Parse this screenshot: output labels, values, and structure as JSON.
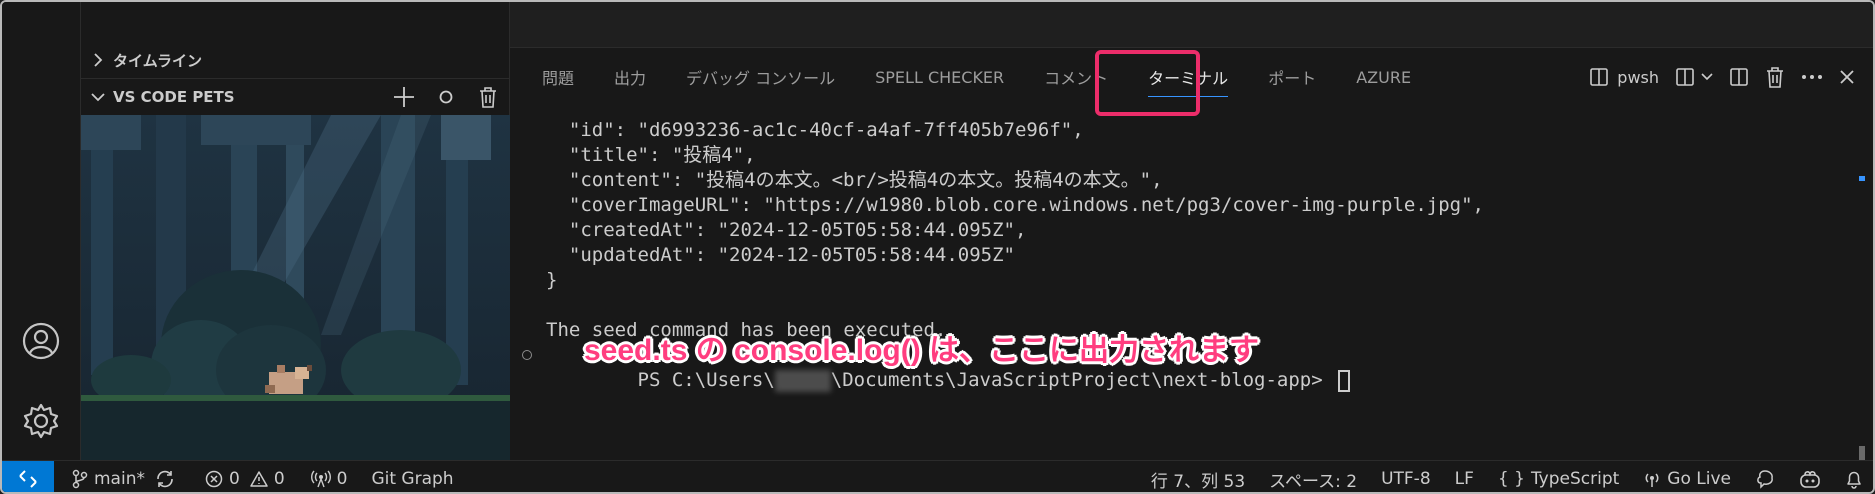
{
  "sidebar": {
    "timeline_label": "タイムライン",
    "pets_label": "VS CODE PETS"
  },
  "panel": {
    "tabs": [
      {
        "label": "問題"
      },
      {
        "label": "出力"
      },
      {
        "label": "デバッグ コンソール"
      },
      {
        "label": "SPELL CHECKER"
      },
      {
        "label": "コメント"
      },
      {
        "label": "ターミナル"
      },
      {
        "label": "ポート"
      },
      {
        "label": "AZURE"
      }
    ],
    "active_tab": "ターミナル",
    "shell_name": "pwsh"
  },
  "terminal": {
    "lines": [
      "  \"id\": \"d6993236-ac1c-40cf-a4af-7ff405b7e96f\",",
      "  \"title\": \"投稿4\",",
      "  \"content\": \"投稿4の本文。<br/>投稿4の本文。投稿4の本文。\",",
      "  \"coverImageURL\": \"https://w1980.blob.core.windows.net/pg3/cover-img-purple.jpg\",",
      "  \"createdAt\": \"2024-12-05T05:58:44.095Z\",",
      "  \"updatedAt\": \"2024-12-05T05:58:44.095Z\"",
      "}"
    ],
    "executed_message": "The seed command has been executed.",
    "prompt_prefix": "PS C:\\Users\\",
    "prompt_suffix": "\\Documents\\JavaScriptProject\\next-blog-app> "
  },
  "annotation": "seed.ts の console.log() は、ここに出力されます",
  "status_bar": {
    "branch": "main*",
    "errors": "0",
    "warnings": "0",
    "ports": "0",
    "git_graph": "Git Graph",
    "position": "行 7、列 53",
    "spaces": "スペース: 2",
    "encoding": "UTF-8",
    "eol": "LF",
    "language": "TypeScript",
    "go_live": "Go Live"
  },
  "colors": {
    "accent": "#0078d4",
    "highlight_border": "#ec2d6a",
    "annotation": "#ff3d7f",
    "tab_underline": "#3794ff"
  },
  "icons": [
    "account-icon",
    "gear-icon",
    "add-icon",
    "circle-icon",
    "trash-icon",
    "split-terminal-icon",
    "launch-profile-icon",
    "split-icon",
    "kill-terminal-icon",
    "more-icon",
    "close-icon",
    "remote-icon",
    "branch-icon",
    "sync-icon",
    "error-icon",
    "warning-icon",
    "broadcast-icon",
    "braces-icon",
    "go-live-icon",
    "feedback-icon",
    "copilot-icon",
    "bell-icon"
  ]
}
